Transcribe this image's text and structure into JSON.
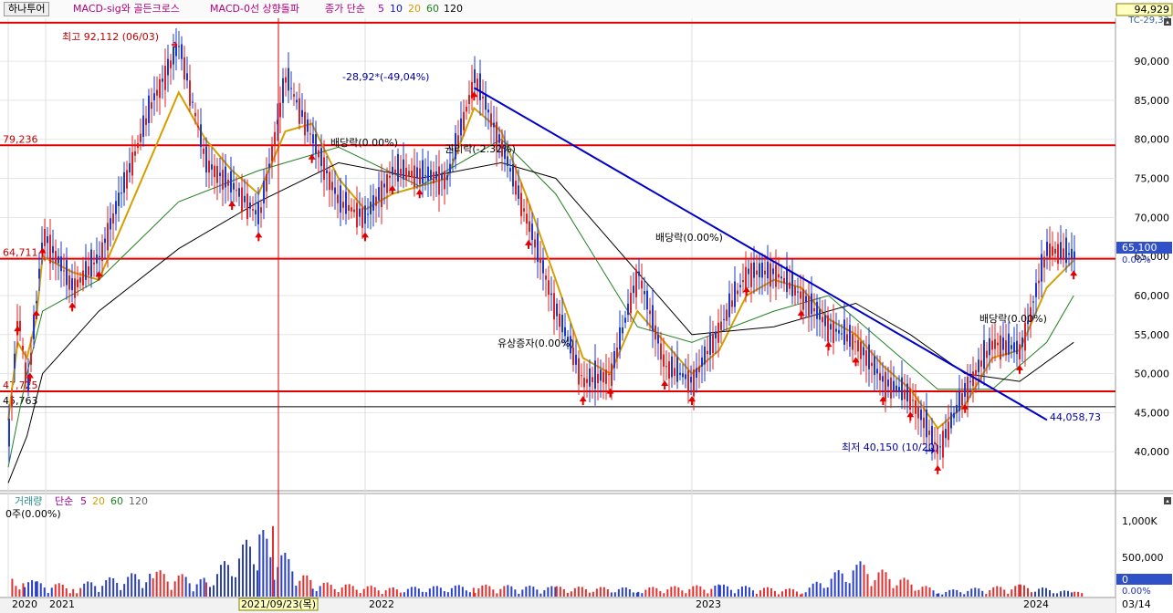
{
  "toolbar": {
    "stock_name": "하나투어",
    "indicators": [
      {
        "label": "MACD-sig와 골든크로스",
        "color": "#b0007a"
      },
      {
        "label": "MACD-0선 상향돌파",
        "color": "#b0007a"
      }
    ],
    "ma_prefix": "종가 단순",
    "ma_periods": [
      {
        "label": "5",
        "color": "#a000a0"
      },
      {
        "label": "10",
        "color": "#1010c0"
      },
      {
        "label": "20",
        "color": "#d4a000"
      },
      {
        "label": "60",
        "color": "#208020"
      },
      {
        "label": "120",
        "color": "#000000"
      }
    ]
  },
  "price_axis": {
    "ticks": [
      "90,000",
      "85,000",
      "80,000",
      "75,000",
      "70,000",
      "65,000",
      "60,000",
      "55,000",
      "50,000",
      "45,000",
      "40,000"
    ],
    "top_box": "94,929",
    "top_small": "TC-29,33",
    "current_box": "65,100",
    "current_pct": "0.00%"
  },
  "volume_axis": {
    "ticks": [
      "1,000K",
      "500,000"
    ],
    "box": "0",
    "pct": "0.00%"
  },
  "volume_panel": {
    "title": "거래량",
    "ma_prefix": "단순",
    "ma_periods": [
      {
        "label": "5",
        "color": "#a000a0"
      },
      {
        "label": "20",
        "color": "#d4a000"
      },
      {
        "label": "60",
        "color": "#208020"
      },
      {
        "label": "120",
        "color": "#666666"
      }
    ],
    "current": "0주(0.00%)"
  },
  "x_axis": {
    "labels": [
      "2020",
      "2021",
      "2022",
      "2023",
      "2024"
    ],
    "crosshair_date": "2021/09/23(목)",
    "right_label": "03/14"
  },
  "annotations": {
    "high": "최고 92,112 (06/03)",
    "low": "최저 40,150 (10/20)",
    "trend_start": "-28,92*(-49,04%)",
    "trend_end": "44,058,73",
    "events": [
      "배당락(0.00%)",
      "권리락(-2.32%)",
      "배당락(0.00%)",
      "유상증자(0.00%)",
      "배당락(0.00%)"
    ]
  },
  "chart_data": {
    "type": "candlestick",
    "title": "하나투어",
    "y_range": [
      35000,
      95500
    ],
    "x_range": [
      "2020",
      "2024-03-14"
    ],
    "horizontal_lines": [
      {
        "label": "79,236",
        "value": 79236,
        "color": "#e00000"
      },
      {
        "label": "64,711",
        "value": 64711,
        "color": "#e00000"
      },
      {
        "label": "47,725",
        "value": 47725,
        "color": "#e00000"
      },
      {
        "label": "45,763",
        "value": 45763,
        "color": "#000000"
      },
      {
        "label": "",
        "value": 94929,
        "color": "#e00000"
      }
    ],
    "trendline": {
      "from": [
        "2022-05",
        86600
      ],
      "to": [
        "2024-03",
        44058.73
      ],
      "color": "#0000c8"
    },
    "price_series": [
      {
        "x": "2020-01",
        "y": 42000
      },
      {
        "x": "2020-04",
        "y": 58000
      },
      {
        "x": "2020-07",
        "y": 48000
      },
      {
        "x": "2020-10",
        "y": 60000
      },
      {
        "x": "2020-12",
        "y": 68000
      },
      {
        "x": "2021-02",
        "y": 61000
      },
      {
        "x": "2021-03",
        "y": 65000
      },
      {
        "x": "2021-05",
        "y": 85000
      },
      {
        "x": "2021-06",
        "y": 92112
      },
      {
        "x": "2021-07",
        "y": 77000
      },
      {
        "x": "2021-08",
        "y": 74000
      },
      {
        "x": "2021-09",
        "y": 70000
      },
      {
        "x": "2021-10",
        "y": 88000
      },
      {
        "x": "2021-11",
        "y": 80000
      },
      {
        "x": "2021-12",
        "y": 72000
      },
      {
        "x": "2022-01",
        "y": 70000
      },
      {
        "x": "2022-02",
        "y": 76000
      },
      {
        "x": "2022-04",
        "y": 75000
      },
      {
        "x": "2022-05",
        "y": 88000
      },
      {
        "x": "2022-06",
        "y": 79000
      },
      {
        "x": "2022-07",
        "y": 69000
      },
      {
        "x": "2022-08",
        "y": 58000
      },
      {
        "x": "2022-09",
        "y": 49000
      },
      {
        "x": "2022-10",
        "y": 50000
      },
      {
        "x": "2022-11",
        "y": 63000
      },
      {
        "x": "2022-12",
        "y": 51000
      },
      {
        "x": "2023-01",
        "y": 49000
      },
      {
        "x": "2023-02",
        "y": 56000
      },
      {
        "x": "2023-03",
        "y": 63000
      },
      {
        "x": "2023-04",
        "y": 63000
      },
      {
        "x": "2023-05",
        "y": 60000
      },
      {
        "x": "2023-06",
        "y": 56000
      },
      {
        "x": "2023-07",
        "y": 54000
      },
      {
        "x": "2023-08",
        "y": 49000
      },
      {
        "x": "2023-09",
        "y": 47000
      },
      {
        "x": "2023-10",
        "y": 40150
      },
      {
        "x": "2023-11",
        "y": 48000
      },
      {
        "x": "2023-12",
        "y": 54000
      },
      {
        "x": "2024-01",
        "y": 53000
      },
      {
        "x": "2024-02",
        "y": 66000
      },
      {
        "x": "2024-03",
        "y": 65100
      }
    ],
    "moving_averages": [
      {
        "name": "20",
        "color": "#d4a000",
        "values": [
          {
            "x": "2020-01",
            "y": 44000
          },
          {
            "x": "2020-04",
            "y": 54000
          },
          {
            "x": "2020-07",
            "y": 52000
          },
          {
            "x": "2020-10",
            "y": 57000
          },
          {
            "x": "2020-12",
            "y": 65000
          },
          {
            "x": "2021-02",
            "y": 63000
          },
          {
            "x": "2021-03",
            "y": 62000
          },
          {
            "x": "2021-05",
            "y": 78000
          },
          {
            "x": "2021-06",
            "y": 86000
          },
          {
            "x": "2021-07",
            "y": 80000
          },
          {
            "x": "2021-08",
            "y": 76000
          },
          {
            "x": "2021-09",
            "y": 73000
          },
          {
            "x": "2021-10",
            "y": 81000
          },
          {
            "x": "2021-11",
            "y": 82000
          },
          {
            "x": "2021-12",
            "y": 75000
          },
          {
            "x": "2022-01",
            "y": 71000
          },
          {
            "x": "2022-02",
            "y": 73000
          },
          {
            "x": "2022-04",
            "y": 75000
          },
          {
            "x": "2022-05",
            "y": 84000
          },
          {
            "x": "2022-06",
            "y": 81000
          },
          {
            "x": "2022-07",
            "y": 72000
          },
          {
            "x": "2022-08",
            "y": 62000
          },
          {
            "x": "2022-09",
            "y": 52000
          },
          {
            "x": "2022-10",
            "y": 50000
          },
          {
            "x": "2022-11",
            "y": 58000
          },
          {
            "x": "2022-12",
            "y": 54000
          },
          {
            "x": "2023-01",
            "y": 50000
          },
          {
            "x": "2023-02",
            "y": 53000
          },
          {
            "x": "2023-03",
            "y": 60000
          },
          {
            "x": "2023-04",
            "y": 62000
          },
          {
            "x": "2023-05",
            "y": 61000
          },
          {
            "x": "2023-06",
            "y": 57000
          },
          {
            "x": "2023-07",
            "y": 55000
          },
          {
            "x": "2023-08",
            "y": 51000
          },
          {
            "x": "2023-09",
            "y": 48000
          },
          {
            "x": "2023-10",
            "y": 43000
          },
          {
            "x": "2023-11",
            "y": 46000
          },
          {
            "x": "2023-12",
            "y": 52000
          },
          {
            "x": "2024-01",
            "y": 53000
          },
          {
            "x": "2024-02",
            "y": 61000
          },
          {
            "x": "2024-03",
            "y": 64500
          }
        ]
      },
      {
        "name": "60",
        "color": "#208020",
        "values": [
          {
            "x": "2020-01",
            "y": 38000
          },
          {
            "x": "2020-07",
            "y": 50000
          },
          {
            "x": "2020-12",
            "y": 58000
          },
          {
            "x": "2021-03",
            "y": 62000
          },
          {
            "x": "2021-06",
            "y": 72000
          },
          {
            "x": "2021-09",
            "y": 76000
          },
          {
            "x": "2021-12",
            "y": 79000
          },
          {
            "x": "2022-03",
            "y": 74000
          },
          {
            "x": "2022-06",
            "y": 80000
          },
          {
            "x": "2022-08",
            "y": 73000
          },
          {
            "x": "2022-11",
            "y": 56000
          },
          {
            "x": "2023-01",
            "y": 54000
          },
          {
            "x": "2023-04",
            "y": 58000
          },
          {
            "x": "2023-06",
            "y": 60000
          },
          {
            "x": "2023-08",
            "y": 54000
          },
          {
            "x": "2023-10",
            "y": 48000
          },
          {
            "x": "2023-12",
            "y": 48000
          },
          {
            "x": "2024-02",
            "y": 54000
          },
          {
            "x": "2024-03",
            "y": 60000
          }
        ]
      },
      {
        "name": "120",
        "color": "#000000",
        "values": [
          {
            "x": "2020-01",
            "y": 36000
          },
          {
            "x": "2020-07",
            "y": 42000
          },
          {
            "x": "2020-12",
            "y": 50000
          },
          {
            "x": "2021-03",
            "y": 58000
          },
          {
            "x": "2021-06",
            "y": 66000
          },
          {
            "x": "2021-09",
            "y": 72000
          },
          {
            "x": "2021-12",
            "y": 77000
          },
          {
            "x": "2022-03",
            "y": 75000
          },
          {
            "x": "2022-06",
            "y": 77000
          },
          {
            "x": "2022-08",
            "y": 75000
          },
          {
            "x": "2022-11",
            "y": 63000
          },
          {
            "x": "2023-01",
            "y": 55000
          },
          {
            "x": "2023-04",
            "y": 56000
          },
          {
            "x": "2023-07",
            "y": 59000
          },
          {
            "x": "2023-09",
            "y": 55000
          },
          {
            "x": "2023-11",
            "y": 50000
          },
          {
            "x": "2024-01",
            "y": 49000
          },
          {
            "x": "2024-03",
            "y": 54000
          }
        ]
      }
    ],
    "volume_series": [
      {
        "x": "2020-02",
        "y": 350000
      },
      {
        "x": "2020-06",
        "y": 300000
      },
      {
        "x": "2020-10",
        "y": 250000
      },
      {
        "x": "2021-02",
        "y": 200000
      },
      {
        "x": "2021-05",
        "y": 450000
      },
      {
        "x": "2021-07",
        "y": 300000
      },
      {
        "x": "2021-09",
        "y": 1150000
      },
      {
        "x": "2021-11",
        "y": 250000
      },
      {
        "x": "2022-02",
        "y": 150000
      },
      {
        "x": "2022-05",
        "y": 200000
      },
      {
        "x": "2022-08",
        "y": 170000
      },
      {
        "x": "2022-11",
        "y": 150000
      },
      {
        "x": "2023-02",
        "y": 200000
      },
      {
        "x": "2023-05",
        "y": 120000
      },
      {
        "x": "2023-07",
        "y": 600000
      },
      {
        "x": "2023-10",
        "y": 100000
      },
      {
        "x": "2024-01",
        "y": 200000
      },
      {
        "x": "2024-03",
        "y": 80000
      }
    ],
    "volume_range": [
      0,
      1400000
    ]
  }
}
